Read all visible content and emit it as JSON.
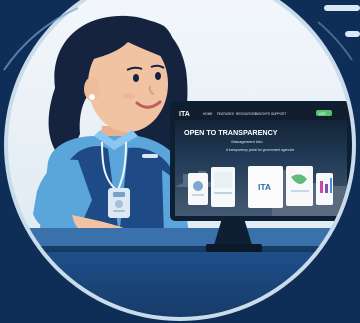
{
  "colors": {
    "background": "#0f2e57",
    "circle_fill": "#edf3f8",
    "circle_ring": "#c9dceb",
    "shirt": "#5aa5d9",
    "vest": "#1e4a86",
    "skin": "#f2c3a3",
    "hair": "#16233f",
    "desk": "#eef4fa",
    "monitor_frame": "#0d1f33",
    "monitor_header": "#111d2c"
  },
  "monitor": {
    "logo": "ITA",
    "nav_links": [
      "HOME",
      "FEATURES",
      "RESOURCES",
      "INSIGHTS",
      "SUPPORT"
    ],
    "headline": "OPEN TO TRANSPARENCY",
    "subheadline": "Management Info",
    "tagline": "A transparency portal for government agencies",
    "center_logo": "ITA",
    "user_badge": "USR"
  },
  "icons": {
    "id_badge": "id-badge-icon",
    "shield": "shield-icon"
  }
}
